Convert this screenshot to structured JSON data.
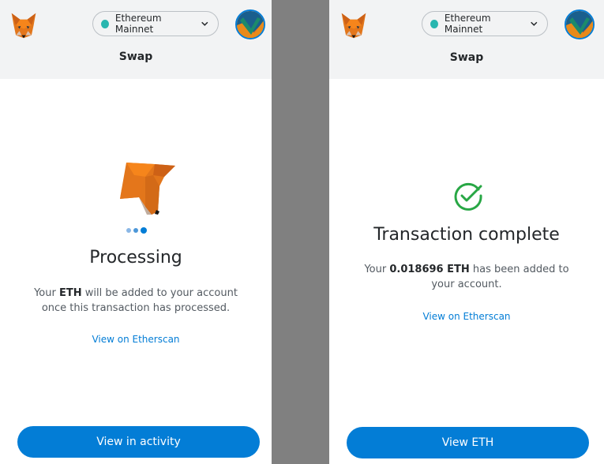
{
  "network": {
    "name": "Ethereum Mainnet",
    "dot_color": "#29b6af"
  },
  "screens": {
    "processing": {
      "title": "Swap",
      "heading": "Processing",
      "desc_prefix": "Your ",
      "desc_token": "ETH",
      "desc_suffix": " will be added to your account once this transaction has processed.",
      "link": "View on Etherscan",
      "button": "View in activity"
    },
    "complete": {
      "title": "Swap",
      "heading": "Transaction complete",
      "desc_prefix": "Your ",
      "desc_amount": "0.018696 ETH",
      "desc_suffix": " has been added to your account.",
      "link": "View on Etherscan",
      "button": "View ETH"
    }
  },
  "icons": {
    "logo": "metamask-fox-icon",
    "avatar": "account-avatar",
    "network_caret": "chevron-down-icon",
    "success": "check-circle-icon",
    "processing": "loading-dots"
  },
  "colors": {
    "accent": "#037dd6",
    "success": "#28a745",
    "header_bg": "#f2f3f4"
  }
}
